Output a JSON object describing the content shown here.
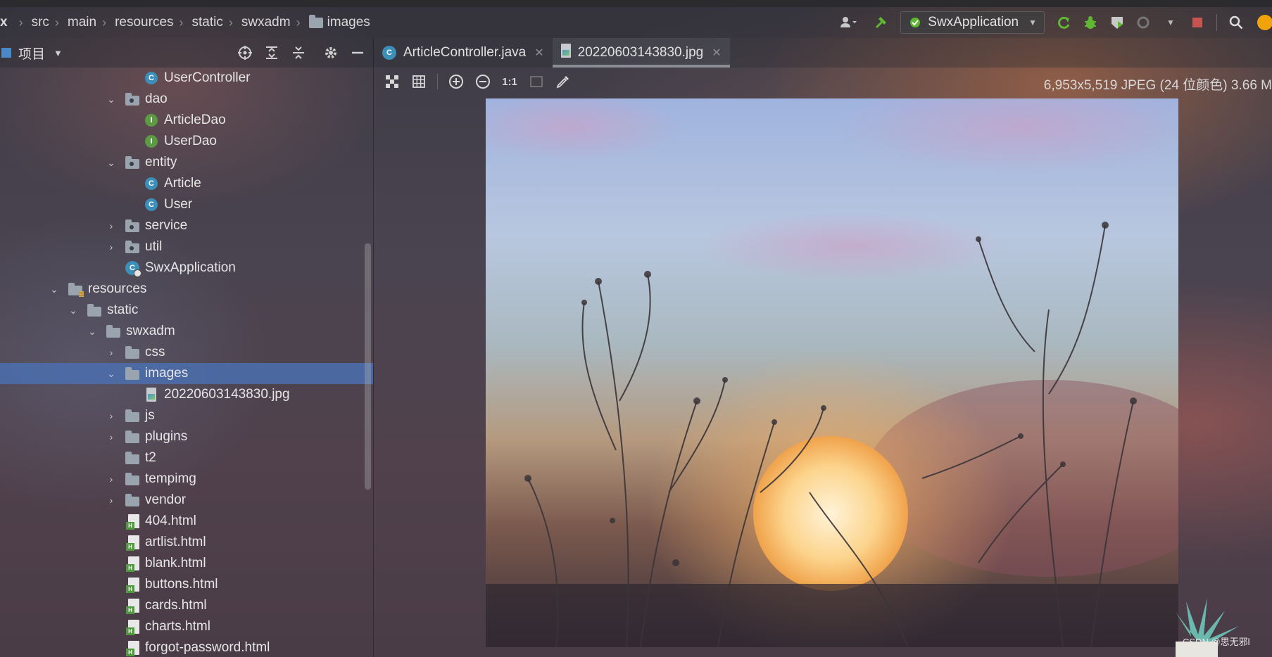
{
  "breadcrumb": {
    "root_partial": "x",
    "items": [
      "src",
      "main",
      "resources",
      "static",
      "swxadm",
      "images"
    ]
  },
  "toolbar": {
    "run_config": "SwxApplication"
  },
  "project_panel": {
    "title": "项目"
  },
  "tree": [
    {
      "label": "UserController",
      "kind": "class",
      "depth": 3
    },
    {
      "label": "dao",
      "kind": "package",
      "depth": 2,
      "expanded": true
    },
    {
      "label": "ArticleDao",
      "kind": "interface",
      "depth": 3
    },
    {
      "label": "UserDao",
      "kind": "interface",
      "depth": 3
    },
    {
      "label": "entity",
      "kind": "package",
      "depth": 2,
      "expanded": true
    },
    {
      "label": "Article",
      "kind": "class",
      "depth": 3
    },
    {
      "label": "User",
      "kind": "class",
      "depth": 3
    },
    {
      "label": "service",
      "kind": "package",
      "depth": 2,
      "expanded": false
    },
    {
      "label": "util",
      "kind": "package",
      "depth": 2,
      "expanded": false
    },
    {
      "label": "SwxApplication",
      "kind": "app",
      "depth": 2
    },
    {
      "label": "resources",
      "kind": "resources",
      "depth": 0,
      "expanded": true
    },
    {
      "label": "static",
      "kind": "folder",
      "depth": 1,
      "expanded": true
    },
    {
      "label": "swxadm",
      "kind": "folder",
      "depth": 2,
      "expanded": true
    },
    {
      "label": "css",
      "kind": "folder",
      "depth": 3,
      "expanded": false
    },
    {
      "label": "images",
      "kind": "folder",
      "depth": 3,
      "expanded": true,
      "selected": true
    },
    {
      "label": "20220603143830.jpg",
      "kind": "image",
      "depth": 4
    },
    {
      "label": "js",
      "kind": "folder",
      "depth": 3,
      "expanded": false
    },
    {
      "label": "plugins",
      "kind": "folder",
      "depth": 3,
      "expanded": false
    },
    {
      "label": "t2",
      "kind": "folder",
      "depth": 3
    },
    {
      "label": "tempimg",
      "kind": "folder",
      "depth": 3,
      "expanded": false
    },
    {
      "label": "vendor",
      "kind": "folder",
      "depth": 3,
      "expanded": false
    },
    {
      "label": "404.html",
      "kind": "html",
      "depth": 3
    },
    {
      "label": "artlist.html",
      "kind": "html",
      "depth": 3
    },
    {
      "label": "blank.html",
      "kind": "html",
      "depth": 3
    },
    {
      "label": "buttons.html",
      "kind": "html",
      "depth": 3
    },
    {
      "label": "cards.html",
      "kind": "html",
      "depth": 3
    },
    {
      "label": "charts.html",
      "kind": "html",
      "depth": 3
    },
    {
      "label": "forgot-password.html",
      "kind": "html",
      "depth": 3
    }
  ],
  "editor_tabs": [
    {
      "label": "ArticleController.java",
      "icon": "class-icon",
      "active": false
    },
    {
      "label": "20220603143830.jpg",
      "icon": "image-file-icon",
      "active": true
    }
  ],
  "image_viewer": {
    "info": "6,953x5,519 JPEG (24 位颜色) 3.66 M",
    "zoom_actual_label": "1:1"
  },
  "watermark": "CSDN @思无邪l",
  "colors": {
    "selection": "#4b6eaf",
    "class_icon": "#3b8fb8",
    "interface_icon": "#5c9a43",
    "run_green": "#5fb832",
    "stop_red": "#c75450"
  }
}
